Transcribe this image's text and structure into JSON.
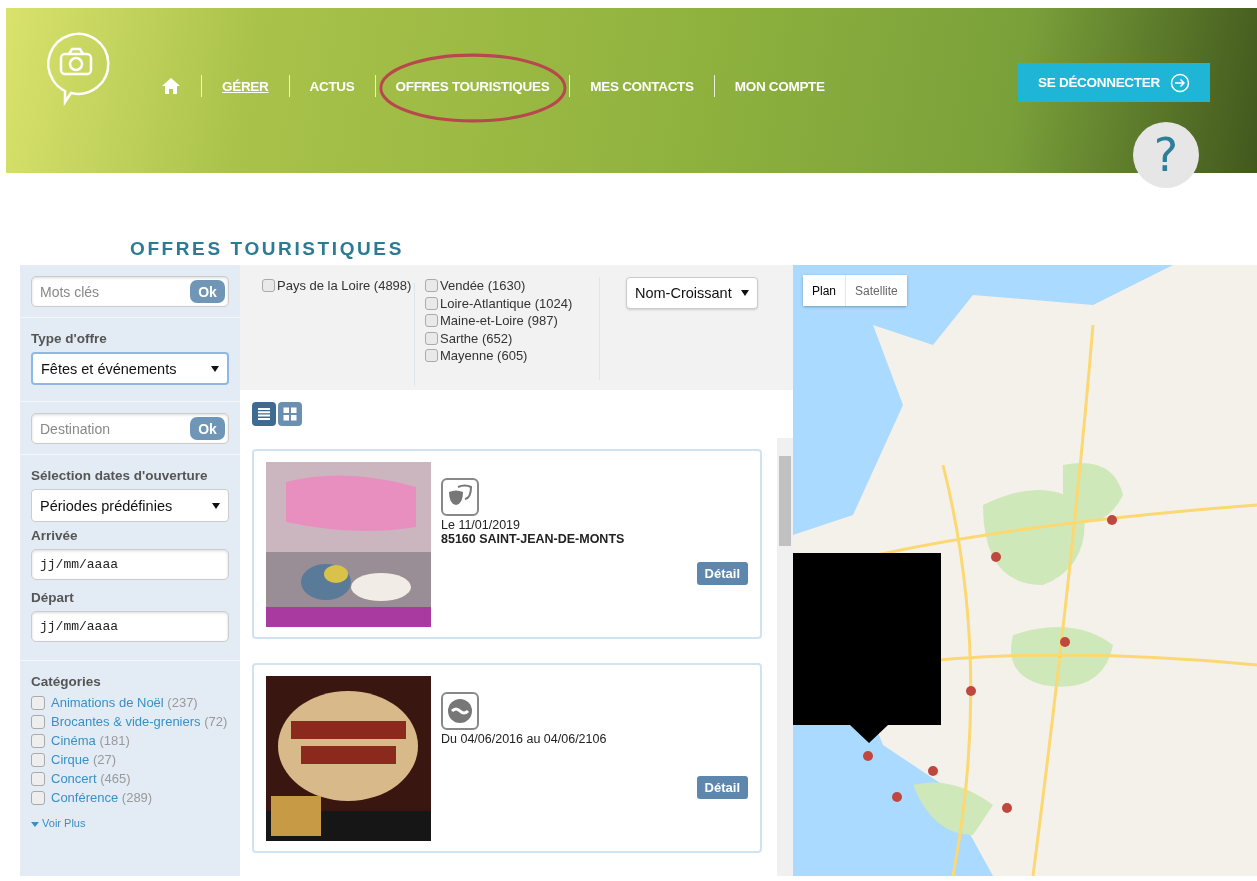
{
  "header": {
    "nav": [
      {
        "kind": "link",
        "label": "GÉRER",
        "selected": true,
        "highlighted": false
      },
      {
        "kind": "link",
        "label": "ACTUS",
        "selected": false,
        "highlighted": false
      },
      {
        "kind": "link",
        "label": "OFFRES TOURISTIQUES",
        "selected": false,
        "highlighted": true
      },
      {
        "kind": "link",
        "label": "MES CONTACTS",
        "selected": false,
        "highlighted": false
      },
      {
        "kind": "link",
        "label": "MON COMPTE",
        "selected": false,
        "highlighted": false
      }
    ],
    "logout_button": "SE DÉCONNECTER",
    "help": "?"
  },
  "page_title": "OFFRES TOURISTIQUES",
  "sidebar": {
    "keywords": {
      "placeholder": "Mots clés",
      "button": "Ok"
    },
    "offer_type": {
      "label": "Type d'offre",
      "value": "Fêtes et événements"
    },
    "destination": {
      "placeholder": "Destination",
      "button": "Ok"
    },
    "dates": {
      "label": "Sélection dates d'ouverture",
      "value": "Périodes prédéfinies",
      "arrival": {
        "label": "Arrivée",
        "placeholder": "jj/mm/aaaa"
      },
      "departure": {
        "label": "Départ",
        "placeholder": "jj/mm/aaaa"
      }
    },
    "categories": {
      "label": "Catégories",
      "items": [
        {
          "name": "Animations de Noël",
          "count": "(237)",
          "checked": false
        },
        {
          "name": "Brocantes & vide-greniers",
          "count": "(72)",
          "checked": false
        },
        {
          "name": "Cinéma",
          "count": "(181)",
          "checked": false
        },
        {
          "name": "Cirque",
          "count": "(27)",
          "checked": false
        },
        {
          "name": "Concert",
          "count": "(465)",
          "checked": false
        },
        {
          "name": "Conférence",
          "count": "(289)",
          "checked": false
        }
      ],
      "more": "Voir Plus"
    }
  },
  "filters": {
    "region": [
      {
        "label": "Pays de la Loire (4898)",
        "checked": false
      }
    ],
    "departments": [
      {
        "label": "Vendée (1630)",
        "checked": false
      },
      {
        "label": "Loire-Atlantique (1024)",
        "checked": false
      },
      {
        "label": "Maine-et-Loire (987)",
        "checked": false
      },
      {
        "label": "Sarthe (652)",
        "checked": false
      },
      {
        "label": "Mayenne (605)",
        "checked": false
      }
    ],
    "sort": "Nom-Croissant"
  },
  "view_modes": [
    {
      "kind": "list",
      "selected": true
    },
    {
      "kind": "grid",
      "selected": false
    }
  ],
  "results": [
    {
      "date": "Le 11/01/2019",
      "place": "85160 SAINT-JEAN-DE-MONTS",
      "button": "Détail"
    },
    {
      "date": "Du 04/06/2016 au 04/06/2106",
      "button": "Détail"
    }
  ],
  "map": {
    "types": [
      {
        "label": "Plan",
        "selected": true
      },
      {
        "label": "Satellite",
        "selected": false
      }
    ]
  }
}
